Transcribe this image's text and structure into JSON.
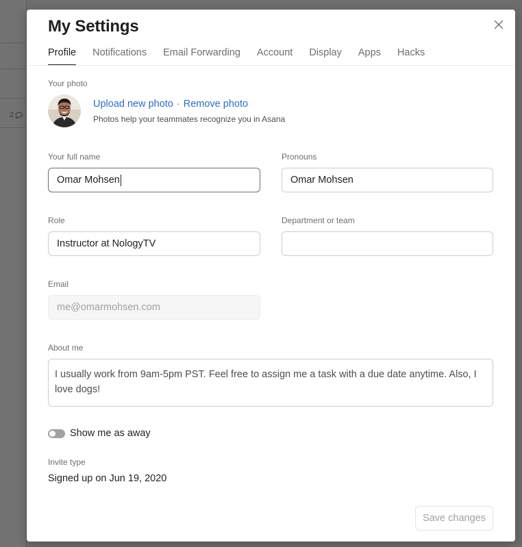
{
  "background": {
    "comment_count": "2"
  },
  "modal": {
    "title": "My Settings",
    "close_icon": "close-icon"
  },
  "tabs": [
    {
      "label": "Profile",
      "active": true
    },
    {
      "label": "Notifications",
      "active": false
    },
    {
      "label": "Email Forwarding",
      "active": false
    },
    {
      "label": "Account",
      "active": false
    },
    {
      "label": "Display",
      "active": false
    },
    {
      "label": "Apps",
      "active": false
    },
    {
      "label": "Hacks",
      "active": false
    }
  ],
  "photo": {
    "label": "Your photo",
    "upload_link": "Upload new photo",
    "separator": "·",
    "remove_link": "Remove photo",
    "help_text": "Photos help your teammates recognize you in Asana"
  },
  "fields": {
    "full_name": {
      "label": "Your full name",
      "value": "Omar Mohsen"
    },
    "pronouns": {
      "label": "Pronouns",
      "value": "Omar Mohsen"
    },
    "role": {
      "label": "Role",
      "value": "Instructor at NologyTV"
    },
    "department": {
      "label": "Department or team",
      "value": ""
    },
    "email": {
      "label": "Email",
      "value": "me@omarmohsen.com"
    },
    "about": {
      "label": "About me",
      "value": "I usually work from 9am-5pm PST. Feel free to assign me a task with a due date anytime. Also, I love dogs!"
    }
  },
  "away_toggle": {
    "label": "Show me as away",
    "on": false
  },
  "invite": {
    "label": "Invite type",
    "value": "Signed up on Jun 19, 2020"
  },
  "save_button": {
    "label": "Save changes",
    "enabled": false
  },
  "colors": {
    "link": "#2f6cc3",
    "text_primary": "#1e1f21",
    "text_secondary": "#6d6e6f",
    "overlay": "#6e6e6e"
  }
}
